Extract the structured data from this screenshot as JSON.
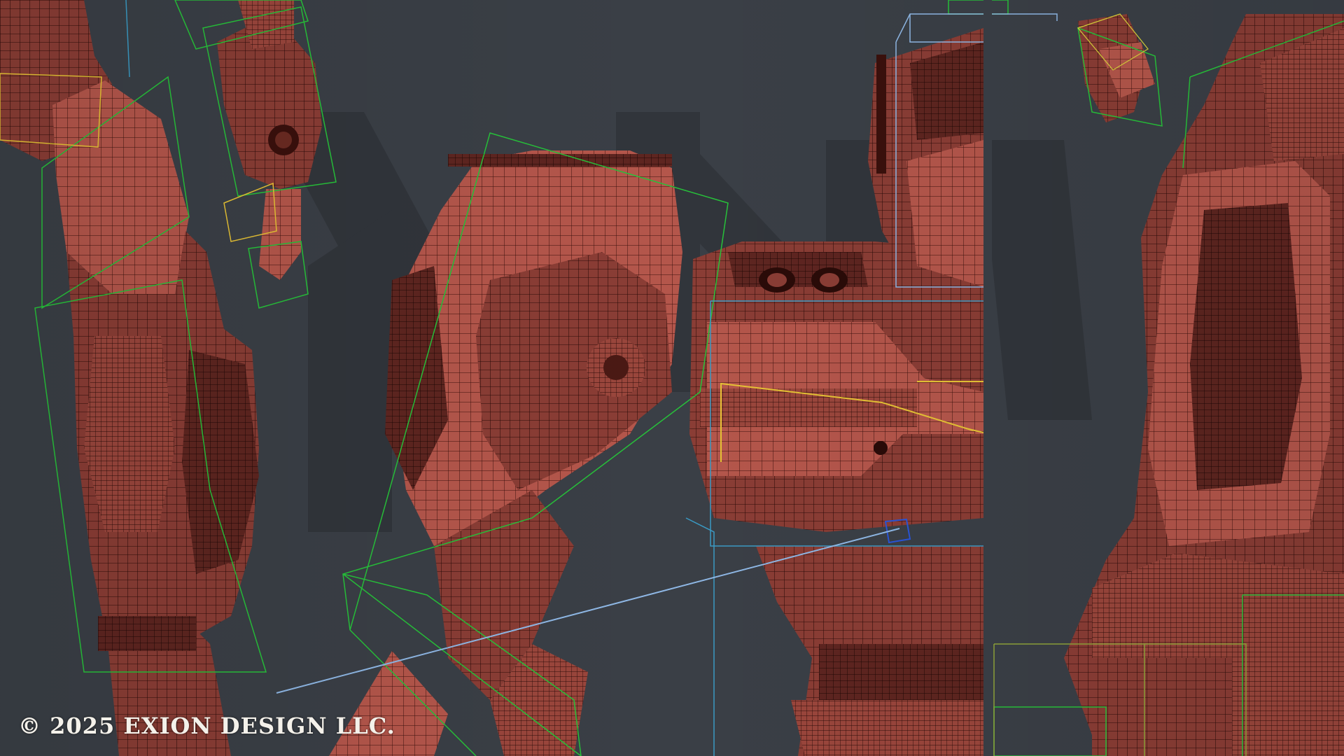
{
  "watermark": {
    "copyright_text": "© 2025 EXION DESIGN LLC."
  },
  "colors": {
    "viewport_background": "#3a3f46",
    "mesh_fill": "#8a3d35",
    "mesh_fill_light": "#b4564b",
    "mesh_fill_dark": "#4a1914",
    "wire_line": "#2a0b08",
    "logo_watermark": "#31353b",
    "bbox_green": "#27c23a",
    "bbox_yellow": "#e6c235",
    "bbox_blue_light": "#8fb8e6",
    "bbox_blue": "#2a55d8",
    "bbox_cyan": "#3a9ac4"
  },
  "scene": {
    "subject": "wireframe robot model in 3D viewport",
    "panels": [
      "left-arm-panel",
      "center-torso-panel",
      "right-leg-panel"
    ]
  }
}
